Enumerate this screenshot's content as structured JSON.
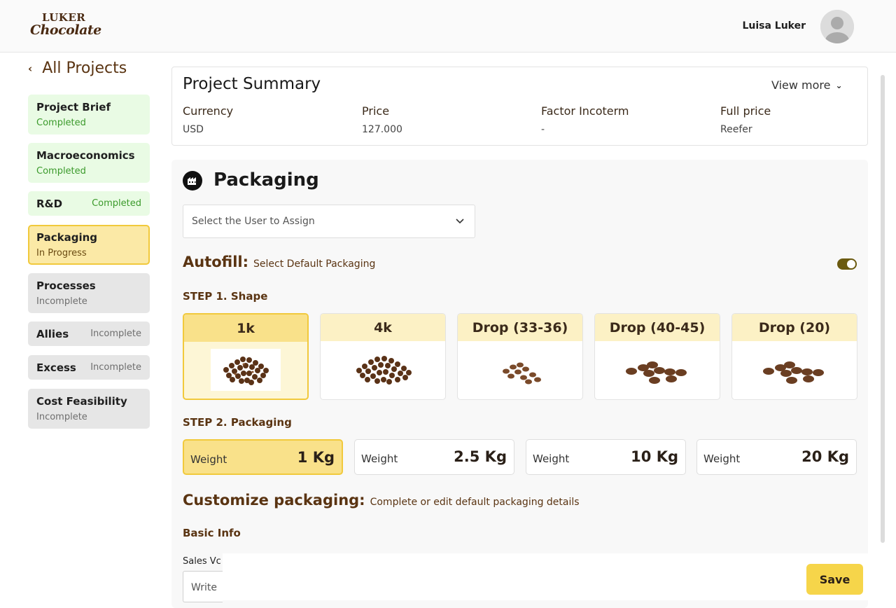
{
  "header": {
    "logo_line1": "LUKER",
    "logo_line2": "Chocolate",
    "user_name": "Luisa Luker"
  },
  "nav": {
    "back_label": "All Projects"
  },
  "sidebar": {
    "items": [
      {
        "label": "Project Brief",
        "status": "Completed"
      },
      {
        "label": "Macroeconomics",
        "status": "Completed"
      },
      {
        "label": "R&D",
        "status": "Completed"
      },
      {
        "label": "Packaging",
        "status": "In Progress"
      },
      {
        "label": "Processes",
        "status": "Incomplete"
      },
      {
        "label": "Allies",
        "status": "Incomplete"
      },
      {
        "label": "Excess",
        "status": "Incomplete"
      },
      {
        "label": "Cost Feasibility",
        "status": "Incomplete"
      }
    ]
  },
  "summary": {
    "title": "Project Summary",
    "view_more": "View more",
    "fields": [
      {
        "label": "Currency",
        "value": "USD"
      },
      {
        "label": "Price",
        "value": "127.000"
      },
      {
        "label": "Factor Incoterm",
        "value": "-"
      },
      {
        "label": "Full price",
        "value": "Reefer"
      }
    ]
  },
  "packaging": {
    "title": "Packaging",
    "assign_placeholder": "Select the User to Assign",
    "autofill_title": "Autofill:",
    "autofill_sub": "Select Default Packaging",
    "autofill_enabled": true,
    "step1": "STEP 1. Shape",
    "shapes": [
      {
        "label": "1k",
        "selected": true
      },
      {
        "label": "4k",
        "selected": false
      },
      {
        "label": "Drop (33-36)",
        "selected": false
      },
      {
        "label": "Drop (40-45)",
        "selected": false
      },
      {
        "label": "Drop (20)",
        "selected": false
      }
    ],
    "step2": "STEP 2. Packaging",
    "weights": [
      {
        "label": "Weight",
        "value": "1 Kg",
        "selected": true
      },
      {
        "label": "Weight",
        "value": "2.5 Kg",
        "selected": false
      },
      {
        "label": "Weight",
        "value": "10 Kg",
        "selected": false
      },
      {
        "label": "Weight",
        "value": "20 Kg",
        "selected": false
      }
    ],
    "customize_title": "Customize packaging:",
    "customize_sub": "Complete or edit default packaging details",
    "basic_info": "Basic Info",
    "sales_label": "Sales Vc",
    "write_placeholder": "Write"
  },
  "actions": {
    "save": "Save"
  },
  "colors": {
    "brand_brown": "#5a3412",
    "accent_yellow": "#f6d54a",
    "completed_green": "#3b9a2b",
    "completed_bg": "#e9fbe4",
    "progress_bg": "#fbe9a6"
  }
}
